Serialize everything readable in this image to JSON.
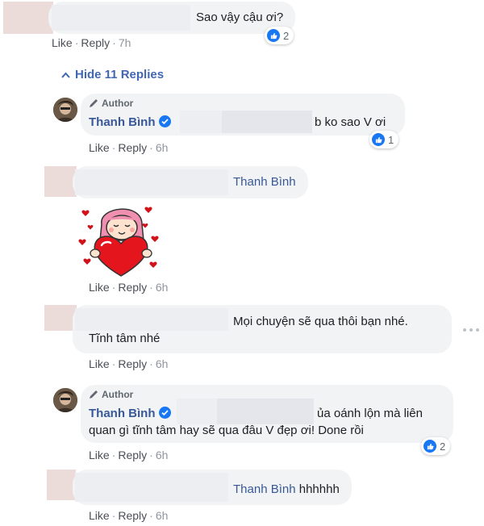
{
  "actions": {
    "like": "Like",
    "reply": "Reply"
  },
  "hide_replies": "Hide 11 Replies",
  "author_label": "Author",
  "comments": [
    {
      "text": "Sao vậy cậu ơi?",
      "time": "7h",
      "reaction_count": "2"
    },
    {
      "name": "Thanh Bình",
      "text": "b ko sao V ơi",
      "time": "6h",
      "reaction_count": "1"
    },
    {
      "mention": "Thanh Bình",
      "time": "6h",
      "sticker": "girl-holding-heart-sticker"
    },
    {
      "line1": "Mọi chuyện sẽ qua thôi bạn nhé.",
      "line2": "Tĩnh tâm nhé",
      "time": "6h"
    },
    {
      "name": "Thanh Bình",
      "line1": "ủa oánh lộn mà liên",
      "line2": "quan gì tĩnh tâm hay sẽ qua đâu V đẹp ơi! Done rồi",
      "time": "6h",
      "reaction_count": "2"
    },
    {
      "mention": "Thanh Bình",
      "text": "hhhhhh",
      "time": "6h"
    }
  ],
  "colors": {
    "link": "#385898",
    "bubble": "#f2f3f5",
    "like_blue": "#1877f2"
  },
  "icons": {
    "like": "thumbs-up-icon",
    "verified": "verified-badge-icon",
    "author": "pencil-icon",
    "collapse": "chevron-up-icon"
  }
}
